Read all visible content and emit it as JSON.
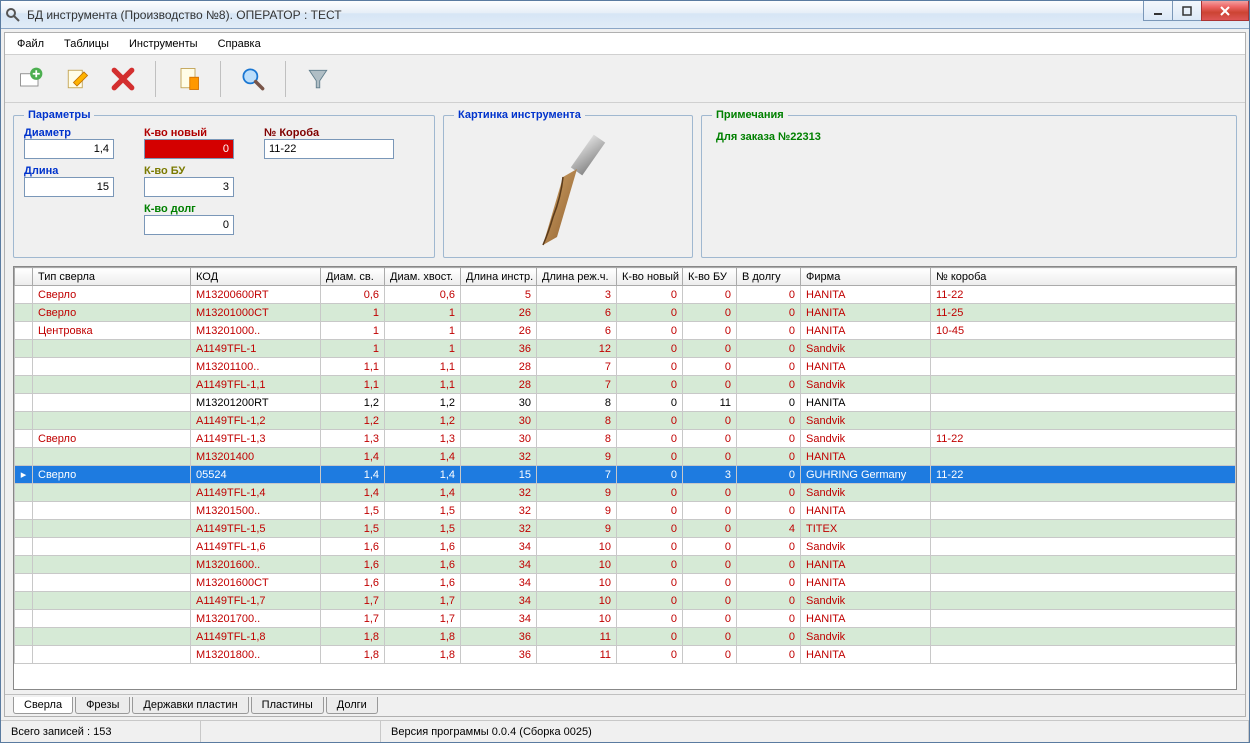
{
  "window": {
    "title": "БД инструмента (Производство №8). ОПЕРАТОР : ТЕСТ"
  },
  "menu": {
    "file": "Файл",
    "tables": "Таблицы",
    "tools": "Инструменты",
    "help": "Справка"
  },
  "params": {
    "legend": "Параметры",
    "diam_label": "Диаметр",
    "diam": "1,4",
    "len_label": "Длина",
    "len": "15",
    "knew_label": "К-во новый",
    "knew": "0",
    "kbu_label": "К-во БУ",
    "kbu": "3",
    "kdolg_label": "К-во долг",
    "kdolg": "0",
    "box_label": "№ Короба",
    "box": "11-22"
  },
  "image": {
    "legend": "Картинка инструмента"
  },
  "notes": {
    "legend": "Примечания",
    "text": "Для заказа №22313"
  },
  "columns": {
    "type": "Тип сверла",
    "code": "КОД",
    "d1": "Диам. св.",
    "d2": "Диам. хвост.",
    "d3": "Длина инстр.",
    "d4": "Длина реж.ч.",
    "kn": "К-во новый",
    "kb": "К-во БУ",
    "dolg": "В долгу",
    "firm": "Фирма",
    "box": "№ короба"
  },
  "rows": [
    {
      "type": "Сверло",
      "code": "M13200600RT",
      "d1": "0,6",
      "d2": "0,6",
      "d3": "5",
      "d4": "3",
      "kn": "0",
      "kb": "0",
      "dolg": "0",
      "firm": "HANITA",
      "box": "11-22",
      "style": "red"
    },
    {
      "type": "Сверло",
      "code": "M13201000CT",
      "d1": "1",
      "d2": "1",
      "d3": "26",
      "d4": "6",
      "kn": "0",
      "kb": "0",
      "dolg": "0",
      "firm": "HANITA",
      "box": "11-25",
      "style": "red"
    },
    {
      "type": "Центровка",
      "code": "M13201000..",
      "d1": "1",
      "d2": "1",
      "d3": "26",
      "d4": "6",
      "kn": "0",
      "kb": "0",
      "dolg": "0",
      "firm": "HANITA",
      "box": "10-45",
      "style": "red"
    },
    {
      "type": "",
      "code": "A1149TFL-1",
      "d1": "1",
      "d2": "1",
      "d3": "36",
      "d4": "12",
      "kn": "0",
      "kb": "0",
      "dolg": "0",
      "firm": "Sandvik",
      "box": "",
      "style": "red"
    },
    {
      "type": "",
      "code": "M13201100..",
      "d1": "1,1",
      "d2": "1,1",
      "d3": "28",
      "d4": "7",
      "kn": "0",
      "kb": "0",
      "dolg": "0",
      "firm": "HANITA",
      "box": "",
      "style": "red"
    },
    {
      "type": "",
      "code": "A1149TFL-1,1",
      "d1": "1,1",
      "d2": "1,1",
      "d3": "28",
      "d4": "7",
      "kn": "0",
      "kb": "0",
      "dolg": "0",
      "firm": "Sandvik",
      "box": "",
      "style": "red"
    },
    {
      "type": "",
      "code": "M13201200RT",
      "d1": "1,2",
      "d2": "1,2",
      "d3": "30",
      "d4": "8",
      "kn": "0",
      "kb": "11",
      "dolg": "0",
      "firm": "HANITA",
      "box": "",
      "style": "black"
    },
    {
      "type": "",
      "code": "A1149TFL-1,2",
      "d1": "1,2",
      "d2": "1,2",
      "d3": "30",
      "d4": "8",
      "kn": "0",
      "kb": "0",
      "dolg": "0",
      "firm": "Sandvik",
      "box": "",
      "style": "red"
    },
    {
      "type": "Сверло",
      "code": "A1149TFL-1,3",
      "d1": "1,3",
      "d2": "1,3",
      "d3": "30",
      "d4": "8",
      "kn": "0",
      "kb": "0",
      "dolg": "0",
      "firm": "Sandvik",
      "box": "11-22",
      "style": "red"
    },
    {
      "type": "",
      "code": "M13201400",
      "d1": "1,4",
      "d2": "1,4",
      "d3": "32",
      "d4": "9",
      "kn": "0",
      "kb": "0",
      "dolg": "0",
      "firm": "HANITA",
      "box": "",
      "style": "red"
    },
    {
      "type": "Сверло",
      "code": "05524",
      "d1": "1,4",
      "d2": "1,4",
      "d3": "15",
      "d4": "7",
      "kn": "0",
      "kb": "3",
      "dolg": "0",
      "firm": "GUHRING    Germany",
      "box": "11-22",
      "style": "sel"
    },
    {
      "type": "",
      "code": "A1149TFL-1,4",
      "d1": "1,4",
      "d2": "1,4",
      "d3": "32",
      "d4": "9",
      "kn": "0",
      "kb": "0",
      "dolg": "0",
      "firm": "Sandvik",
      "box": "",
      "style": "red"
    },
    {
      "type": "",
      "code": "M13201500..",
      "d1": "1,5",
      "d2": "1,5",
      "d3": "32",
      "d4": "9",
      "kn": "0",
      "kb": "0",
      "dolg": "0",
      "firm": "HANITA",
      "box": "",
      "style": "red"
    },
    {
      "type": "",
      "code": "A1149TFL-1,5",
      "d1": "1,5",
      "d2": "1,5",
      "d3": "32",
      "d4": "9",
      "kn": "0",
      "kb": "0",
      "dolg": "4",
      "firm": "TITEX",
      "box": "",
      "style": "red"
    },
    {
      "type": "",
      "code": "A1149TFL-1,6",
      "d1": "1,6",
      "d2": "1,6",
      "d3": "34",
      "d4": "10",
      "kn": "0",
      "kb": "0",
      "dolg": "0",
      "firm": "Sandvik",
      "box": "",
      "style": "red"
    },
    {
      "type": "",
      "code": "M13201600..",
      "d1": "1,6",
      "d2": "1,6",
      "d3": "34",
      "d4": "10",
      "kn": "0",
      "kb": "0",
      "dolg": "0",
      "firm": "HANITA",
      "box": "",
      "style": "red"
    },
    {
      "type": "",
      "code": "M13201600CT",
      "d1": "1,6",
      "d2": "1,6",
      "d3": "34",
      "d4": "10",
      "kn": "0",
      "kb": "0",
      "dolg": "0",
      "firm": "HANITA",
      "box": "",
      "style": "red"
    },
    {
      "type": "",
      "code": "A1149TFL-1,7",
      "d1": "1,7",
      "d2": "1,7",
      "d3": "34",
      "d4": "10",
      "kn": "0",
      "kb": "0",
      "dolg": "0",
      "firm": "Sandvik",
      "box": "",
      "style": "red"
    },
    {
      "type": "",
      "code": "M13201700..",
      "d1": "1,7",
      "d2": "1,7",
      "d3": "34",
      "d4": "10",
      "kn": "0",
      "kb": "0",
      "dolg": "0",
      "firm": "HANITA",
      "box": "",
      "style": "red"
    },
    {
      "type": "",
      "code": "A1149TFL-1,8",
      "d1": "1,8",
      "d2": "1,8",
      "d3": "36",
      "d4": "11",
      "kn": "0",
      "kb": "0",
      "dolg": "0",
      "firm": "Sandvik",
      "box": "",
      "style": "red"
    },
    {
      "type": "",
      "code": "M13201800..",
      "d1": "1,8",
      "d2": "1,8",
      "d3": "36",
      "d4": "11",
      "kn": "0",
      "kb": "0",
      "dolg": "0",
      "firm": "HANITA",
      "box": "",
      "style": "red"
    }
  ],
  "tabs": {
    "t1": "Сверла",
    "t2": "Фрезы",
    "t3": "Державки пластин",
    "t4": "Пластины",
    "t5": "Долги"
  },
  "status": {
    "records": "Всего записей : 153",
    "version": "Версия программы 0.0.4    (Сборка 0025)"
  }
}
